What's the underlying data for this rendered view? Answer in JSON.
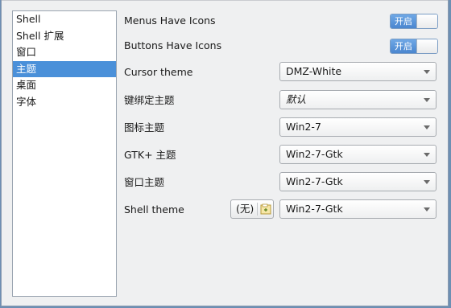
{
  "sidebar": {
    "items": [
      {
        "label": "Shell"
      },
      {
        "label": "Shell 扩展"
      },
      {
        "label": "窗口"
      },
      {
        "label": "主题"
      },
      {
        "label": "桌面"
      },
      {
        "label": "字体"
      }
    ],
    "selected_index": 3
  },
  "switches": {
    "menus_have_icons": {
      "label": "Menus Have Icons",
      "state": "开启"
    },
    "buttons_have_icons": {
      "label": "Buttons Have Icons",
      "state": "开启"
    }
  },
  "settings": {
    "cursor_theme": {
      "label": "Cursor theme",
      "value": "DMZ-White"
    },
    "keybinding_theme": {
      "label": "键绑定主题",
      "value": "默认"
    },
    "icon_theme": {
      "label": "图标主题",
      "value": "Win2-7"
    },
    "gtk_theme": {
      "label": "GTK+ 主题",
      "value": "Win2-7-Gtk"
    },
    "window_theme": {
      "label": "窗口主题",
      "value": "Win2-7-Gtk"
    },
    "shell_theme": {
      "label": "Shell theme",
      "file_button": "(无)",
      "value": "Win2-7-Gtk"
    }
  },
  "colors": {
    "selection": "#4a90d9",
    "switch_on": "#4a86cf",
    "window_bg": "#eff0f1"
  },
  "icons": {
    "dropdown": "chevron-down-icon",
    "file_chooser": "folder-open-icon"
  }
}
